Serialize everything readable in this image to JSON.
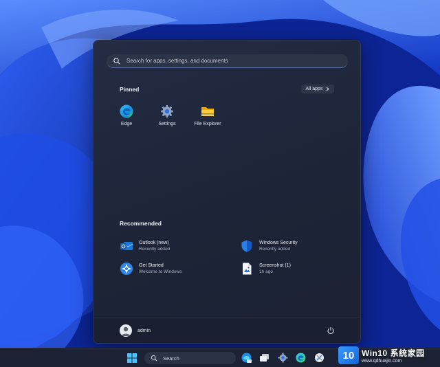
{
  "start_menu": {
    "search": {
      "placeholder": "Search for apps, settings, and documents"
    },
    "pinned": {
      "title": "Pinned",
      "all_apps_label": "All apps",
      "apps": [
        {
          "label": "Edge",
          "icon": "edge-icon"
        },
        {
          "label": "Settings",
          "icon": "gear-icon"
        },
        {
          "label": "File Explorer",
          "icon": "folder-icon"
        }
      ]
    },
    "recommended": {
      "title": "Recommended",
      "items": [
        {
          "name": "Outlook (new)",
          "sub": "Recently added",
          "icon": "outlook-icon"
        },
        {
          "name": "Windows Security",
          "sub": "Recently added",
          "icon": "shield-icon"
        },
        {
          "name": "Get Started",
          "sub": "Welcome to Windows",
          "icon": "get-started-icon"
        },
        {
          "name": "Screenshot (1)",
          "sub": "1h ago",
          "icon": "image-file-icon"
        }
      ]
    },
    "user": {
      "name": "admin"
    }
  },
  "taskbar": {
    "search_label": "Search",
    "apps": [
      "windows-start-icon",
      "copilot-icon",
      "task-view-icon",
      "gear-icon",
      "edge-icon",
      "snipping-tool-icon"
    ]
  },
  "watermark": {
    "logo": "10",
    "main": "Win10 系统家园",
    "url": "www.qdhuajin.com"
  },
  "colors": {
    "wallpaper": "#1a46d8",
    "menu_bg": "#1d2437",
    "accent": "#3a9bff"
  }
}
